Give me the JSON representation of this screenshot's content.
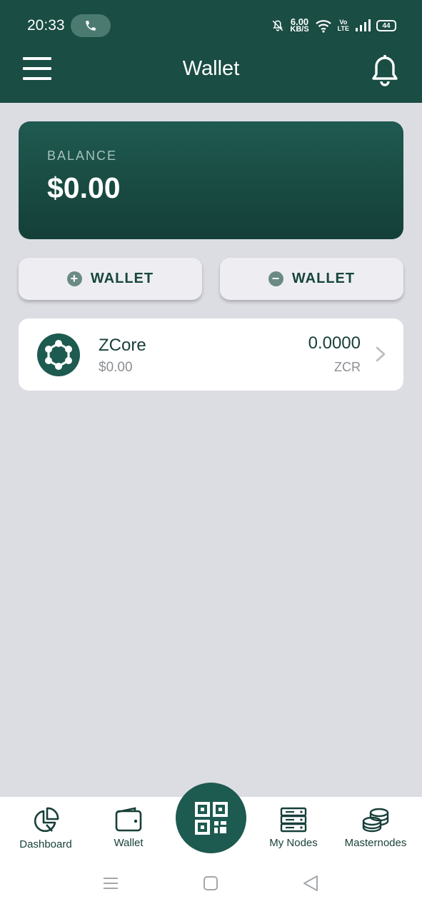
{
  "status_bar": {
    "time": "20:33",
    "net_speed_value": "6.00",
    "net_speed_unit": "KB/S",
    "volte_top": "Vo",
    "volte_bottom": "LTE",
    "battery": "44",
    "icons": [
      "phone-icon",
      "mute-bell-icon",
      "wifi-icon",
      "signal-icon",
      "battery-icon"
    ]
  },
  "header": {
    "title": "Wallet",
    "menu_icon": "hamburger-menu-icon",
    "notification_icon": "bell-icon"
  },
  "balance": {
    "label": "BALANCE",
    "value": "$0.00"
  },
  "actions": {
    "add_label": "WALLET",
    "add_icon": "plus-circle-icon",
    "remove_label": "WALLET",
    "remove_icon": "minus-circle-icon"
  },
  "coins": [
    {
      "name": "ZCore",
      "fiat_value": "$0.00",
      "amount": "0.0000",
      "symbol": "ZCR",
      "icon": "zcore-logo-icon"
    }
  ],
  "bottom_nav": {
    "items": [
      {
        "label": "Dashboard",
        "icon": "pie-chart-icon"
      },
      {
        "label": "Wallet",
        "icon": "wallet-icon"
      },
      {
        "label": "My Nodes",
        "icon": "server-icon"
      },
      {
        "label": "Masternodes",
        "icon": "coins-stack-icon"
      }
    ],
    "center_icon": "qr-code-icon"
  },
  "system_nav": [
    "recent-apps-icon",
    "home-icon",
    "back-icon"
  ],
  "colors": {
    "primary": "#1a4d44",
    "background": "#dcdde3",
    "card": "#ffffff",
    "muted_text": "#8b8f93"
  }
}
